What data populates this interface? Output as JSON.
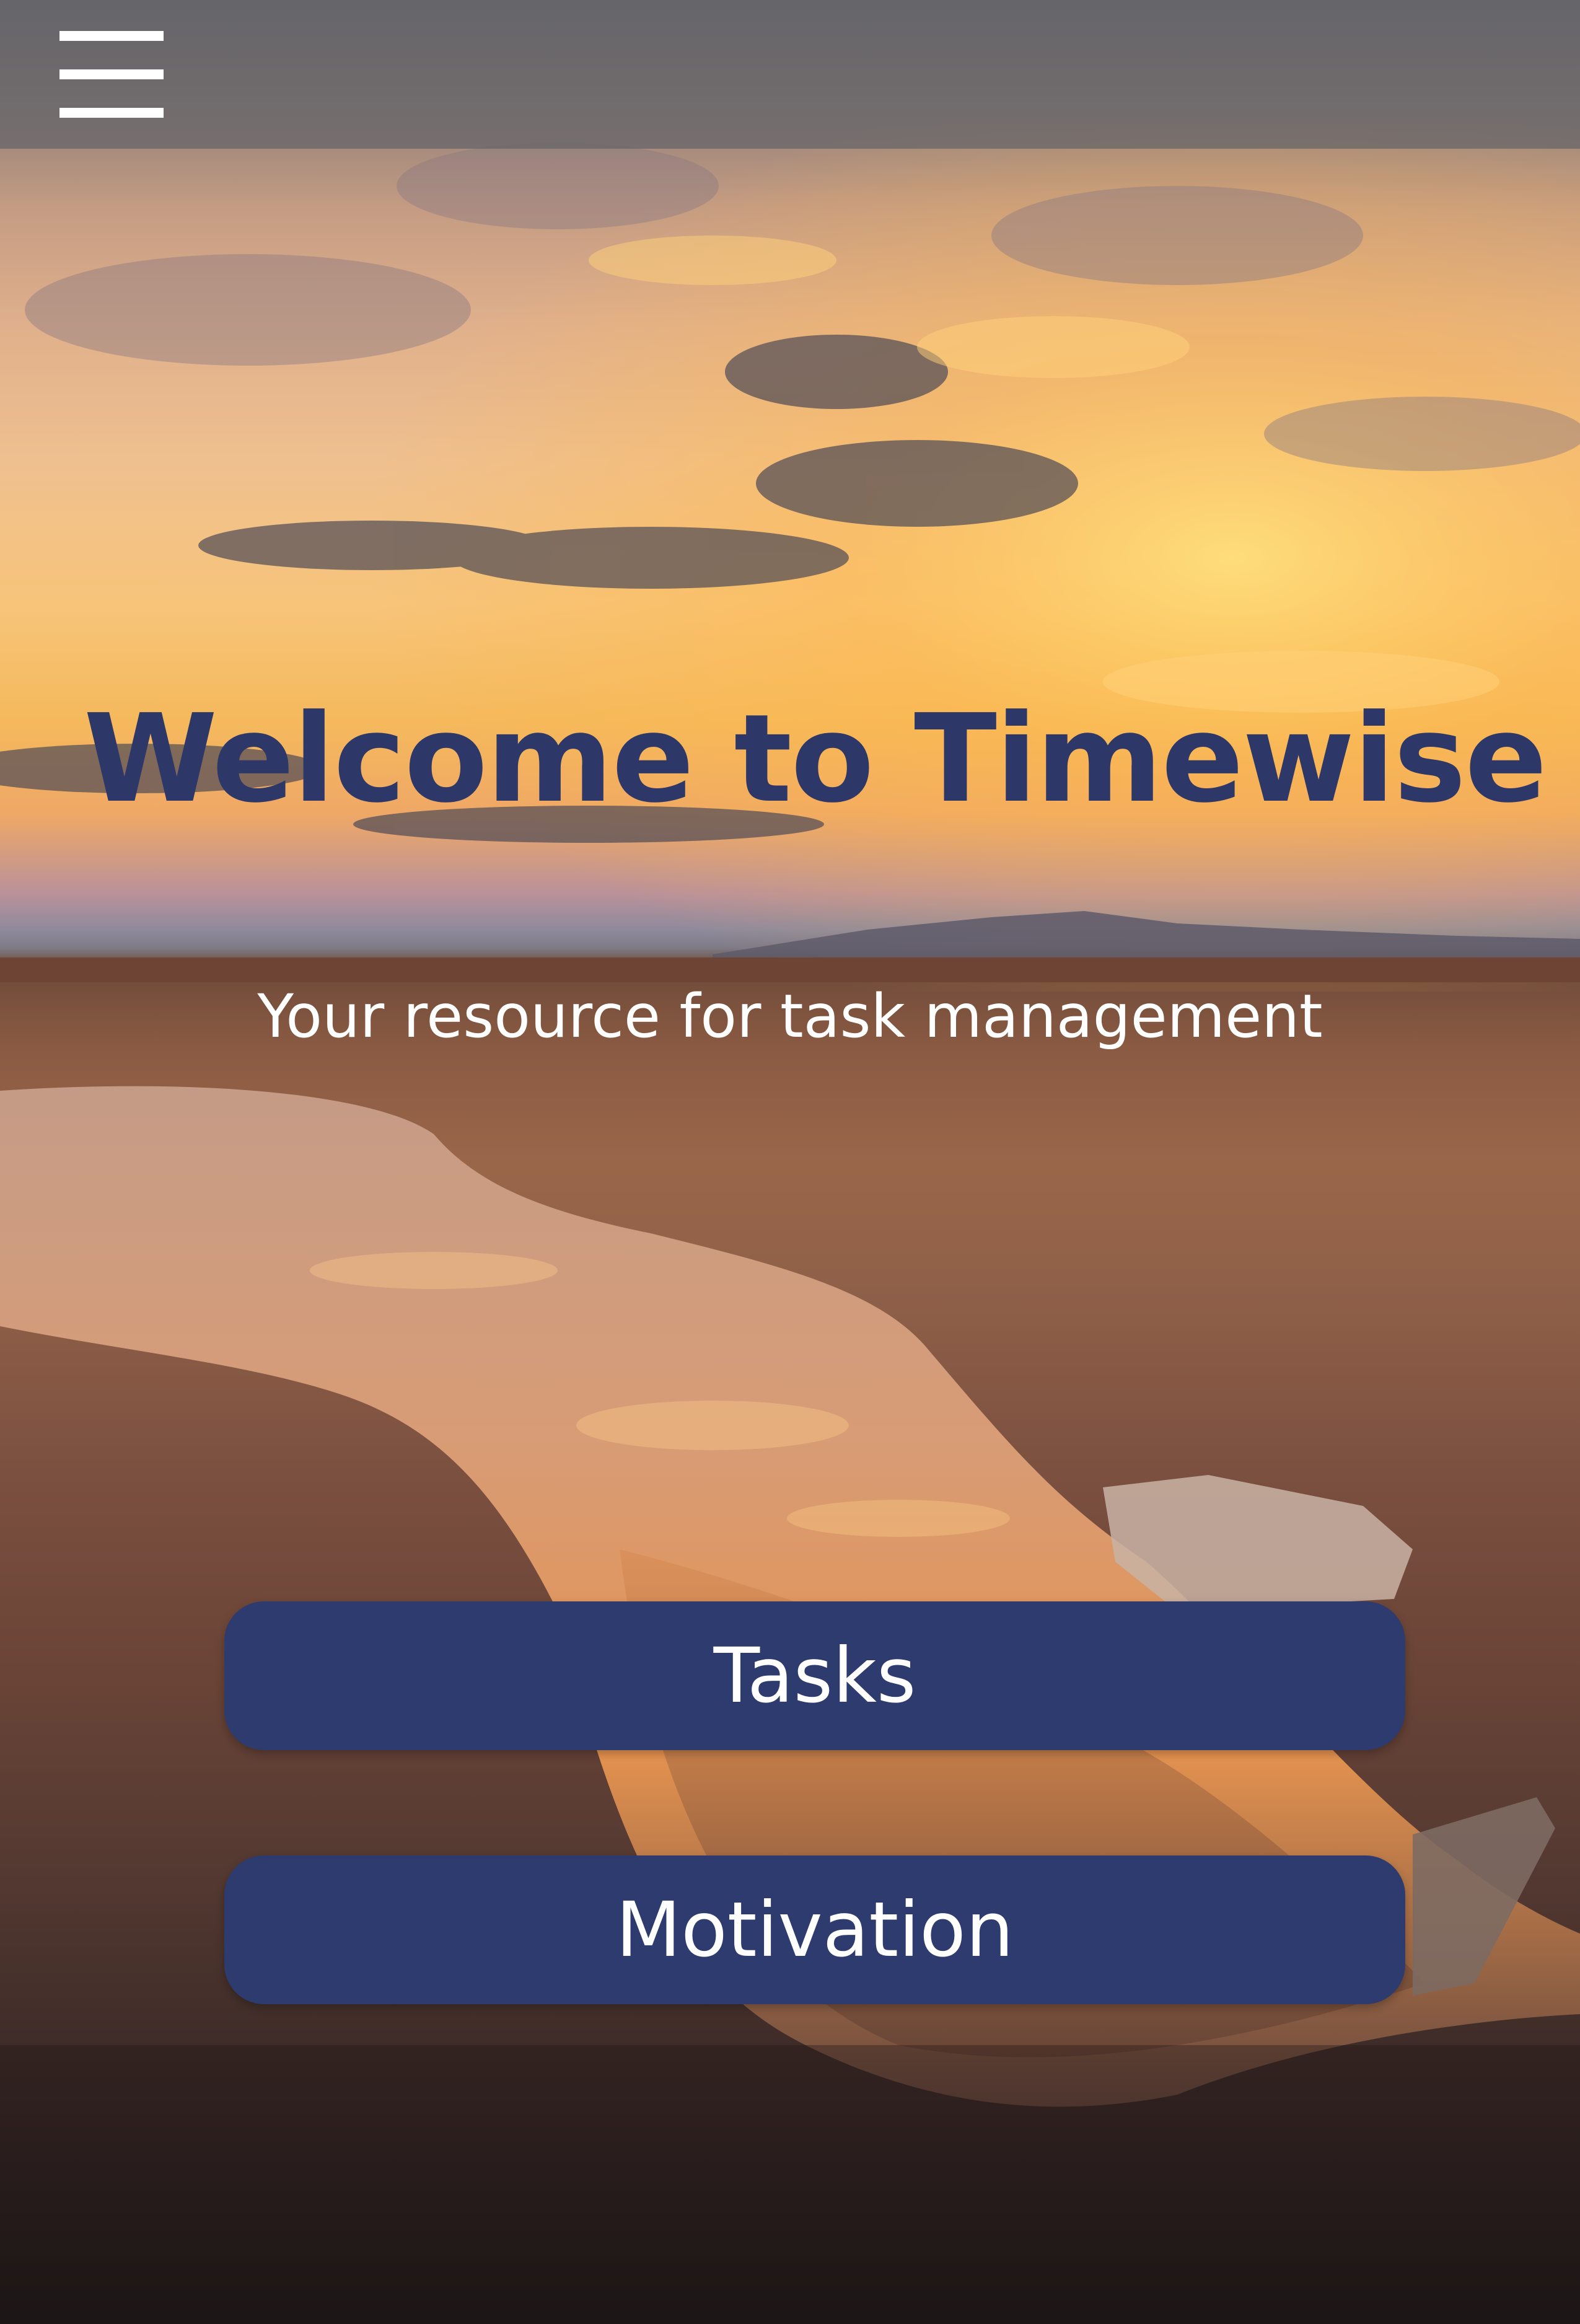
{
  "header": {
    "menu_icon": "hamburger-menu-icon"
  },
  "hero": {
    "title": "Welcome to Timewise",
    "subtitle": "Your resource for task management",
    "title_color": "#2e3868"
  },
  "buttons": {
    "tasks_label": "Tasks",
    "motivation_label": "Motivation",
    "color": "#2e3b6e"
  }
}
